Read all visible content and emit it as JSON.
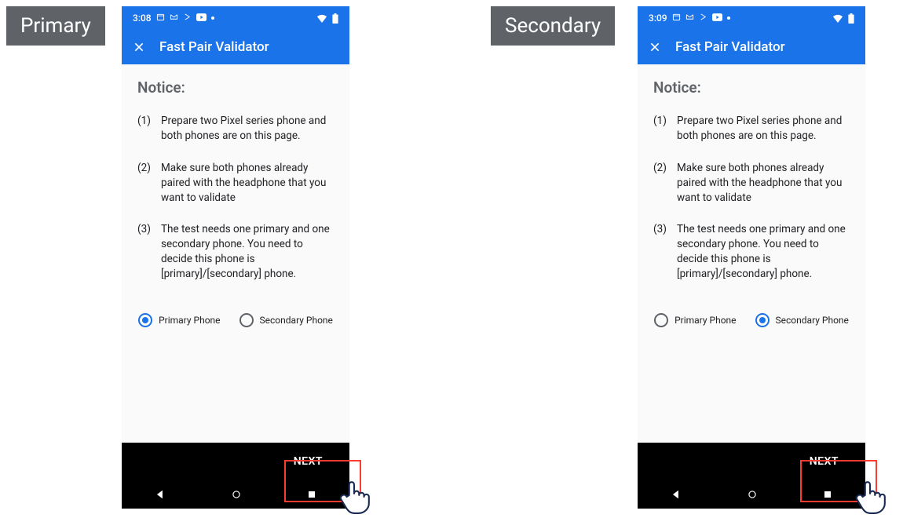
{
  "labels": {
    "primary": "Primary",
    "secondary": "Secondary"
  },
  "status": {
    "time_left": "3:08",
    "time_right": "3:09",
    "icons_note": "calendar, gmail, cast, youtube, dot | wifi, battery"
  },
  "app": {
    "title": "Fast Pair Validator",
    "close_icon": "close-x"
  },
  "notice_heading": "Notice:",
  "steps": [
    {
      "n": "(1)",
      "t": "Prepare two Pixel series phone and both phones are on this page."
    },
    {
      "n": "(2)",
      "t": "Make sure both phones already paired with the headphone that you want to validate"
    },
    {
      "n": "(3)",
      "t": "The test needs one primary and one secondary phone. You need to decide this phone is [primary]/[secondary] phone."
    }
  ],
  "radio": {
    "primary": "Primary Phone",
    "secondary": "Secondary Phone"
  },
  "next_label": "NEXT"
}
